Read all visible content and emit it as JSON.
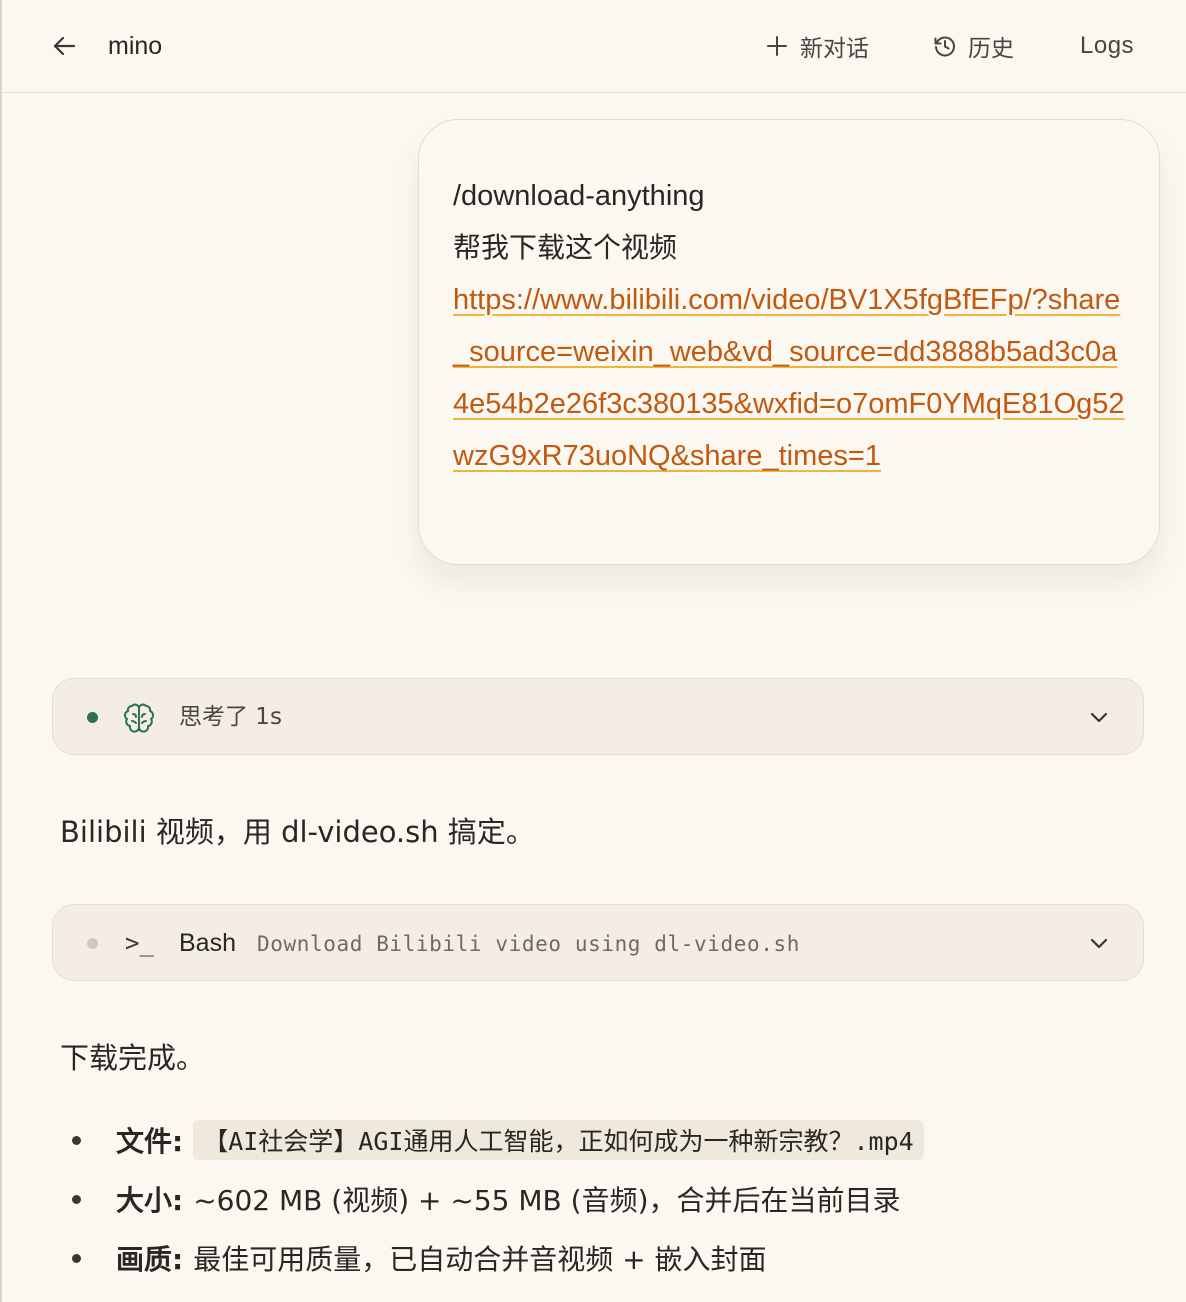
{
  "header": {
    "title": "mino",
    "new_chat_label": "新对话",
    "history_label": "历史",
    "logs_label": "Logs"
  },
  "user_message": {
    "command": "/download-anything",
    "text": "帮我下载这个视频",
    "link": "https://www.bilibili.com/video/BV1X5fgBfEFp/?share_source=weixin_web&vd_source=dd3888b5ad3c0a4e54b2e26f3c380135&wxfid=o7omF0YMqE81Og52wzG9xR73uoNQ&share_times=1"
  },
  "thinking": {
    "label": "思考了 1s",
    "status_color": "#2f6f58"
  },
  "assistant_intro": "Bilibili 视频，用 dl-video.sh 搞定。",
  "tool_call": {
    "prompt_symbol": ">_",
    "name": "Bash",
    "description": "Download Bilibili video using dl-video.sh"
  },
  "result": {
    "heading": "下载完成。",
    "items": [
      {
        "key": "文件:",
        "value": "【AI社会学】AGI通用人工智能，正如何成为一种新宗教？.mp4"
      },
      {
        "key": "大小:",
        "value": "~602 MB (视频) + ~55 MB (音频)，合并后在当前目录"
      },
      {
        "key": "画质:",
        "value": "最佳可用质量，已自动合并音视频 + 嵌入封面"
      }
    ]
  },
  "colors": {
    "background": "#fbf8f2",
    "link": "#c2590f",
    "link_underline": "#f0b43a",
    "card_bg": "#f3ede3"
  }
}
